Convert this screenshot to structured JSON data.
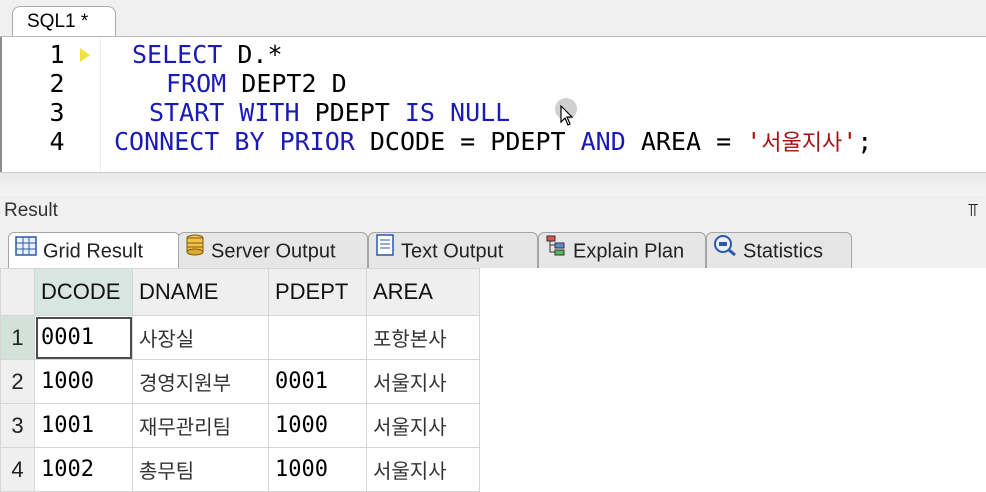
{
  "editor": {
    "tab_label": "SQL1 *",
    "lines": [
      {
        "num": "1",
        "tokens": [
          {
            "t": "SELECT",
            "c": "kw"
          },
          {
            "t": " D.*",
            "c": "tx"
          }
        ],
        "indent": 130
      },
      {
        "num": "2",
        "tokens": [
          {
            "t": "FROM",
            "c": "kw"
          },
          {
            "t": " DEPT2 D",
            "c": "tx"
          }
        ],
        "indent": 164
      },
      {
        "num": "3",
        "tokens": [
          {
            "t": "START WITH",
            "c": "kw"
          },
          {
            "t": " PDEPT ",
            "c": "tx"
          },
          {
            "t": "IS NULL",
            "c": "kw"
          }
        ],
        "indent": 147
      },
      {
        "num": "4",
        "tokens": [
          {
            "t": "CONNECT BY PRIOR",
            "c": "kw"
          },
          {
            "t": " DCODE = PDEPT ",
            "c": "tx"
          },
          {
            "t": "AND",
            "c": "kw"
          },
          {
            "t": " AREA = ",
            "c": "tx"
          },
          {
            "t": "'",
            "c": "str"
          },
          {
            "t": "서울지사",
            "c": "str hangul"
          },
          {
            "t": "'",
            "c": "str"
          },
          {
            "t": ";",
            "c": "tx"
          }
        ],
        "indent": 112
      }
    ]
  },
  "result": {
    "title": "Result",
    "pin_icon": "pin-icon",
    "tabs": [
      {
        "label": "Grid Result",
        "icon": "grid-icon",
        "active": true
      },
      {
        "label": "Server Output",
        "icon": "server-output-icon",
        "active": false
      },
      {
        "label": "Text Output",
        "icon": "text-output-icon",
        "active": false
      },
      {
        "label": "Explain Plan",
        "icon": "explain-plan-icon",
        "active": false
      },
      {
        "label": "Statistics",
        "icon": "statistics-icon",
        "active": false
      }
    ],
    "grid": {
      "columns": [
        "DCODE",
        "DNAME",
        "PDEPT",
        "AREA"
      ],
      "rows": [
        {
          "num": "1",
          "DCODE": "0001",
          "DNAME": "사장실",
          "PDEPT": "",
          "AREA": "포항본사"
        },
        {
          "num": "2",
          "DCODE": "1000",
          "DNAME": "경영지원부",
          "PDEPT": "0001",
          "AREA": "서울지사"
        },
        {
          "num": "3",
          "DCODE": "1001",
          "DNAME": "재무관리팀",
          "PDEPT": "1000",
          "AREA": "서울지사"
        },
        {
          "num": "4",
          "DCODE": "1002",
          "DNAME": "총무팀",
          "PDEPT": "1000",
          "AREA": "서울지사"
        }
      ]
    }
  },
  "colors": {
    "keyword": "#1a1ab8",
    "string": "#a31515",
    "selected_header": "#d7e6e0"
  }
}
